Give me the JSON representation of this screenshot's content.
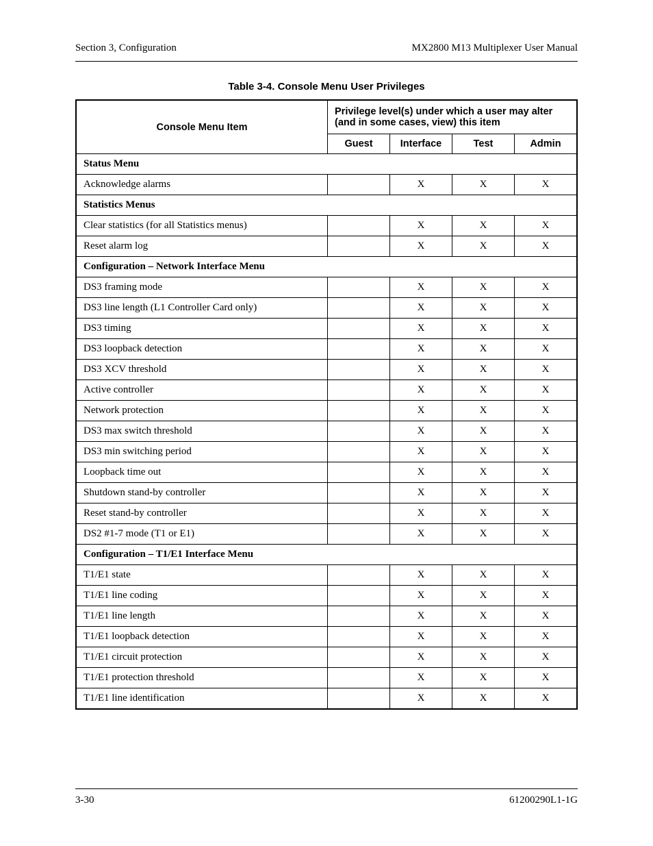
{
  "header": {
    "left": "Section 3, Configuration",
    "right": "MX2800 M13 Multiplexer User Manual"
  },
  "table": {
    "caption": "Table 3-4.  Console Menu User Privileges",
    "col_item": "Console Menu Item",
    "priv_banner": "Privilege level(s) under which a user may alter (and in some cases, view) this item",
    "cols": [
      "Guest",
      "Interface",
      "Test",
      "Admin"
    ],
    "rows": [
      {
        "type": "section",
        "label": "Status Menu"
      },
      {
        "type": "data",
        "label": "Acknowledge alarms",
        "g": "",
        "i": "X",
        "t": "X",
        "a": "X"
      },
      {
        "type": "section",
        "label": "Statistics Menus"
      },
      {
        "type": "data",
        "label": "Clear statistics (for all Statistics menus)",
        "g": "",
        "i": "X",
        "t": "X",
        "a": "X"
      },
      {
        "type": "data",
        "label": "Reset alarm log",
        "g": "",
        "i": "X",
        "t": "X",
        "a": "X"
      },
      {
        "type": "section",
        "label": "Configuration – Network Interface Menu"
      },
      {
        "type": "data",
        "label": "DS3 framing mode",
        "g": "",
        "i": "X",
        "t": "X",
        "a": "X"
      },
      {
        "type": "data",
        "label": "DS3 line length (L1 Controller Card only)",
        "g": "",
        "i": "X",
        "t": "X",
        "a": "X"
      },
      {
        "type": "data",
        "label": "DS3 timing",
        "g": "",
        "i": "X",
        "t": "X",
        "a": "X"
      },
      {
        "type": "data",
        "label": "DS3 loopback detection",
        "g": "",
        "i": "X",
        "t": "X",
        "a": "X"
      },
      {
        "type": "data",
        "label": "DS3 XCV threshold",
        "g": "",
        "i": "X",
        "t": "X",
        "a": "X"
      },
      {
        "type": "data",
        "label": "Active controller",
        "g": "",
        "i": "X",
        "t": "X",
        "a": "X"
      },
      {
        "type": "data",
        "label": "Network protection",
        "g": "",
        "i": "X",
        "t": "X",
        "a": "X"
      },
      {
        "type": "data",
        "label": "DS3 max switch threshold",
        "g": "",
        "i": "X",
        "t": "X",
        "a": "X"
      },
      {
        "type": "data",
        "label": "DS3 min switching period",
        "g": "",
        "i": "X",
        "t": "X",
        "a": "X"
      },
      {
        "type": "data",
        "label": "Loopback time out",
        "g": "",
        "i": "X",
        "t": "X",
        "a": "X"
      },
      {
        "type": "data",
        "label": "Shutdown stand-by controller",
        "g": "",
        "i": "X",
        "t": "X",
        "a": "X"
      },
      {
        "type": "data",
        "label": "Reset stand-by controller",
        "g": "",
        "i": "X",
        "t": "X",
        "a": "X"
      },
      {
        "type": "data",
        "label": "DS2 #1-7 mode (T1 or E1)",
        "g": "",
        "i": "X",
        "t": "X",
        "a": "X"
      },
      {
        "type": "section",
        "label": "Configuration – T1/E1 Interface Menu"
      },
      {
        "type": "data",
        "label": "T1/E1 state",
        "g": "",
        "i": "X",
        "t": "X",
        "a": "X"
      },
      {
        "type": "data",
        "label": "T1/E1 line coding",
        "g": "",
        "i": "X",
        "t": "X",
        "a": "X"
      },
      {
        "type": "data",
        "label": "T1/E1 line length",
        "g": "",
        "i": "X",
        "t": "X",
        "a": "X"
      },
      {
        "type": "data",
        "label": "T1/E1 loopback detection",
        "g": "",
        "i": "X",
        "t": "X",
        "a": "X"
      },
      {
        "type": "data",
        "label": "T1/E1 circuit protection",
        "g": "",
        "i": "X",
        "t": "X",
        "a": "X"
      },
      {
        "type": "data",
        "label": "T1/E1 protection threshold",
        "g": "",
        "i": "X",
        "t": "X",
        "a": "X"
      },
      {
        "type": "data",
        "label": "T1/E1 line identification",
        "g": "",
        "i": "X",
        "t": "X",
        "a": "X"
      }
    ]
  },
  "footer": {
    "left": "3-30",
    "right": "61200290L1-1G"
  }
}
